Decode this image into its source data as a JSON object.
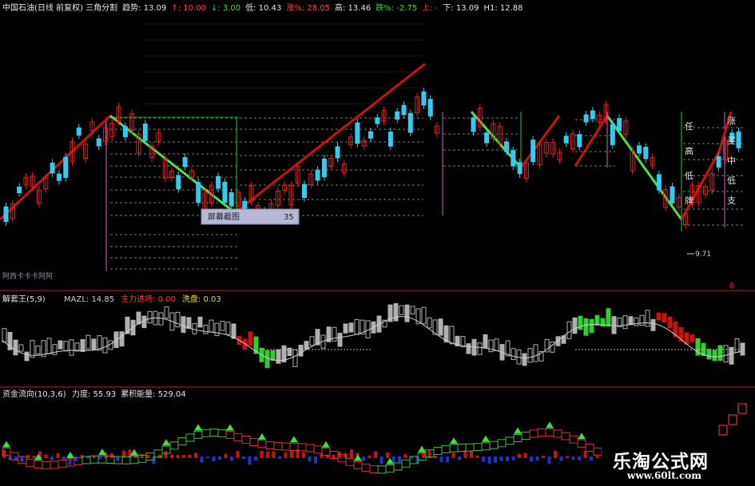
{
  "main_header": [
    {
      "text": "中国石油(日线 前复权) 三角分割",
      "color": "#e6e6e6"
    },
    {
      "text": "趋势: 13.09",
      "color": "#e6e6e6"
    },
    {
      "text": "↑: 10.00",
      "color": "#ff4040"
    },
    {
      "text": "↓: 3.00",
      "color": "#33dd33"
    },
    {
      "text": "低: 10.43",
      "color": "#e6e6e6"
    },
    {
      "text": "涨%: 28.05",
      "color": "#ff4040"
    },
    {
      "text": "高: 13.46",
      "color": "#e6e6e6"
    },
    {
      "text": "跌%: -2.75",
      "color": "#33dd33"
    },
    {
      "text": "上: -",
      "color": "#ff4040"
    },
    {
      "text": "下: 13.09",
      "color": "#e6e6e6"
    },
    {
      "text": "H1: 12.88",
      "color": "#e6e6e6"
    }
  ],
  "tooltip": {
    "label": "屏幕截图",
    "value": "35"
  },
  "side_labels": [
    "任",
    "高",
    "低",
    "牌"
  ],
  "right_labels": [
    "涨",
    "买",
    "中",
    "低",
    "支"
  ],
  "low_marker": "9.71",
  "left_note": "阿西卡卡卡阿阿",
  "right_badge": "6",
  "panel2": {
    "title": "解套王(5,9)",
    "items": [
      {
        "text": "MAZL: 14.85",
        "color": "#cccccc"
      },
      {
        "text": "主力进场: 0.00",
        "color": "#ff4040"
      },
      {
        "text": "洗盘: 0.03",
        "color": "#e8e800"
      }
    ]
  },
  "panel3": {
    "title": "资金流向(10,3,6)",
    "items": [
      {
        "text": "力度: 55.93",
        "color": "#e6e6e6"
      },
      {
        "text": "累积能量: 529.04",
        "color": "#e6e6e6"
      }
    ]
  },
  "watermark": {
    "title": "乐淘公式网",
    "url": "www.60lt.com"
  },
  "colors": {
    "up": "#e02020",
    "down": "#33ccee",
    "ma": "#d8d8d8",
    "green": "#22cc22",
    "red": "#cc1111",
    "blue": "#2233cc",
    "panel_border": "#8a1010",
    "grid": "#808080"
  }
}
